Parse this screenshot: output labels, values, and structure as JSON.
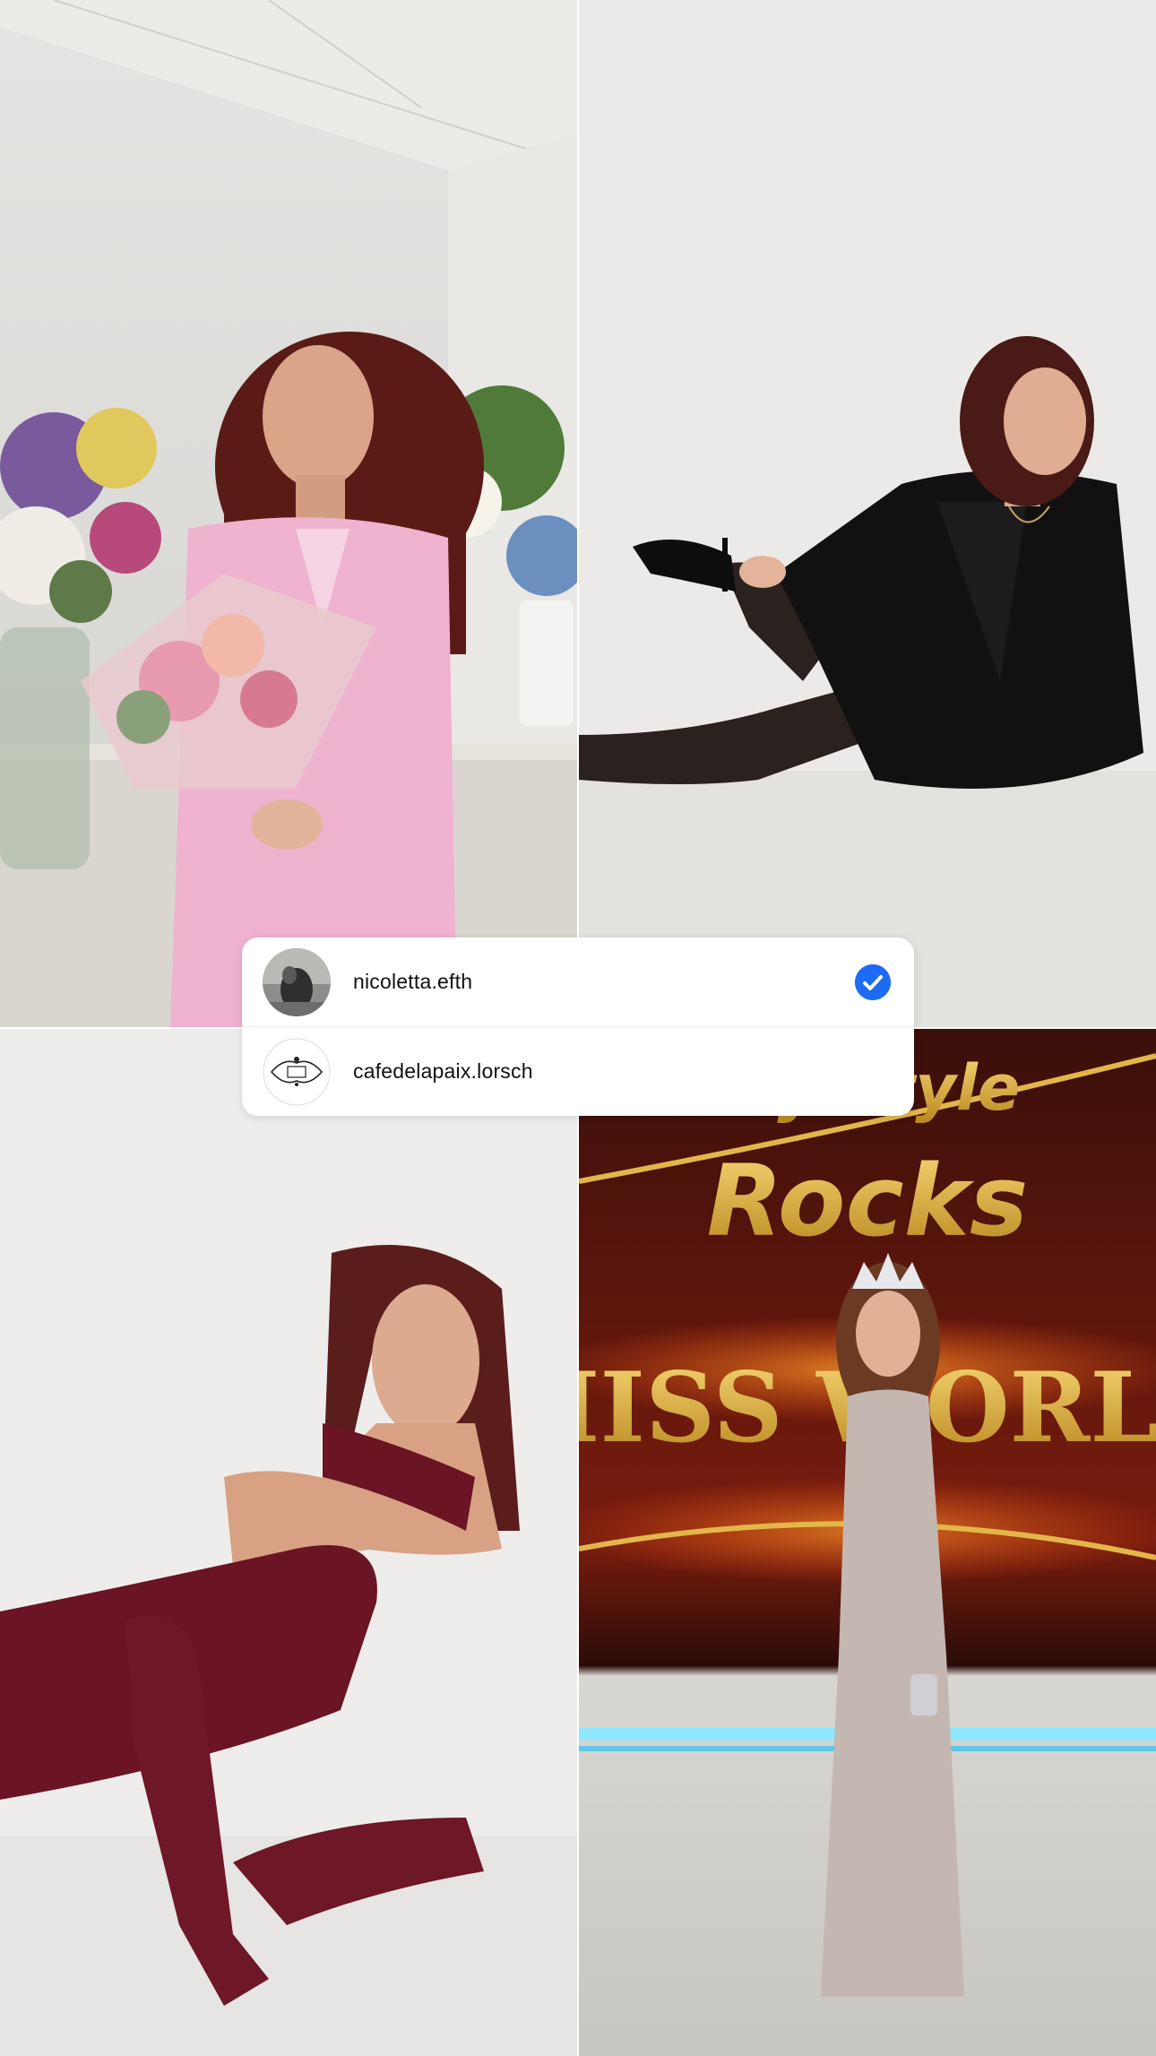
{
  "photos": [
    {
      "id": "photo-1",
      "description_icon": "photo-pink-suit-flowers"
    },
    {
      "id": "photo-2",
      "description_icon": "photo-black-blazer-pose"
    },
    {
      "id": "photo-3",
      "description_icon": "photo-burgundy-dress"
    },
    {
      "id": "photo-4",
      "description_icon": "photo-miss-world-stage"
    }
  ],
  "stage_sign": {
    "line1": "My Style",
    "line2": "Rocks",
    "line3": "MISS WORLD"
  },
  "tags": [
    {
      "username": "nicoletta.efth",
      "verified": true,
      "avatar_icon": "profile-photo-avatar"
    },
    {
      "username": "cafedelapaix.lorsch",
      "verified": false,
      "avatar_icon": "cafe-logo-avatar"
    }
  ],
  "colors": {
    "verified": "#1d6bf2",
    "card_bg": "#ffffff",
    "text": "#111111"
  }
}
